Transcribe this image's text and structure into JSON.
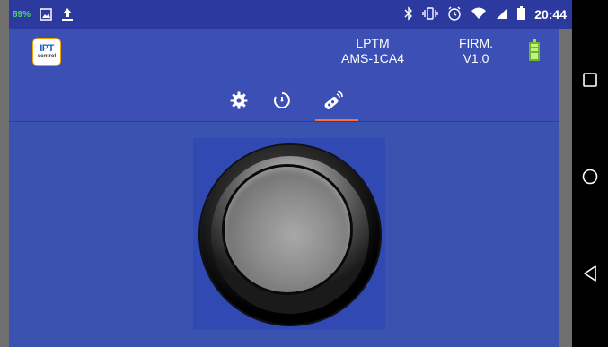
{
  "status_bar": {
    "battery_percent": "89%",
    "time": "20:44",
    "icons": [
      "gallery-icon",
      "upload-icon",
      "bluetooth-icon",
      "vibrate-icon",
      "alarm-icon",
      "wifi-icon",
      "signal-icon",
      "battery-icon"
    ]
  },
  "header": {
    "logo": {
      "top": "IPT",
      "bottom": "control"
    },
    "device_name": "LPTM",
    "device_id": "AMS-1CA4",
    "firm_label": "FIRM.",
    "firm_version": "V1.0",
    "battery_level": 1.0
  },
  "tabs": [
    {
      "name": "settings",
      "icon": "gear-icon",
      "active": false
    },
    {
      "name": "timer",
      "icon": "timer-icon",
      "active": false
    },
    {
      "name": "remote",
      "icon": "remote-icon",
      "active": true
    }
  ],
  "colors": {
    "status_bar": "#2c3aa0",
    "header": "#3b4fb5",
    "content": "#3a53b0",
    "tab_indicator": "#ff6d3a",
    "battery_pct_text": "#4cd964"
  },
  "nav_bar": [
    "square-icon",
    "circle-icon",
    "back-triangle-icon"
  ]
}
